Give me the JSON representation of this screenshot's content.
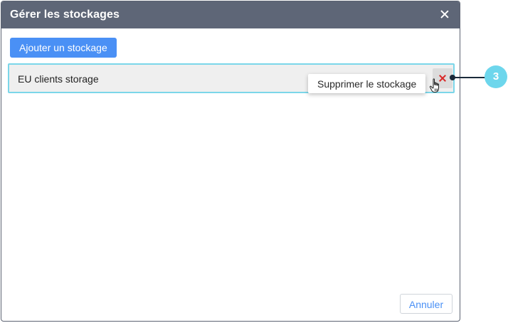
{
  "dialog": {
    "title": "Gérer les stockages",
    "close_icon": "close-icon",
    "add_button_label": "Ajouter un stockage",
    "cancel_button_label": "Annuler"
  },
  "storages": [
    {
      "name": "EU clients storage",
      "delete_icon": "close-icon"
    }
  ],
  "tooltip": {
    "text": "Supprimer le stockage"
  },
  "callout": {
    "number": "3"
  },
  "colors": {
    "header_bg": "#5e6677",
    "primary": "#4a90f5",
    "row_highlight_border": "#7bd6e9",
    "delete_x": "#d92a2a",
    "callout_badge": "#6dd6ec"
  }
}
